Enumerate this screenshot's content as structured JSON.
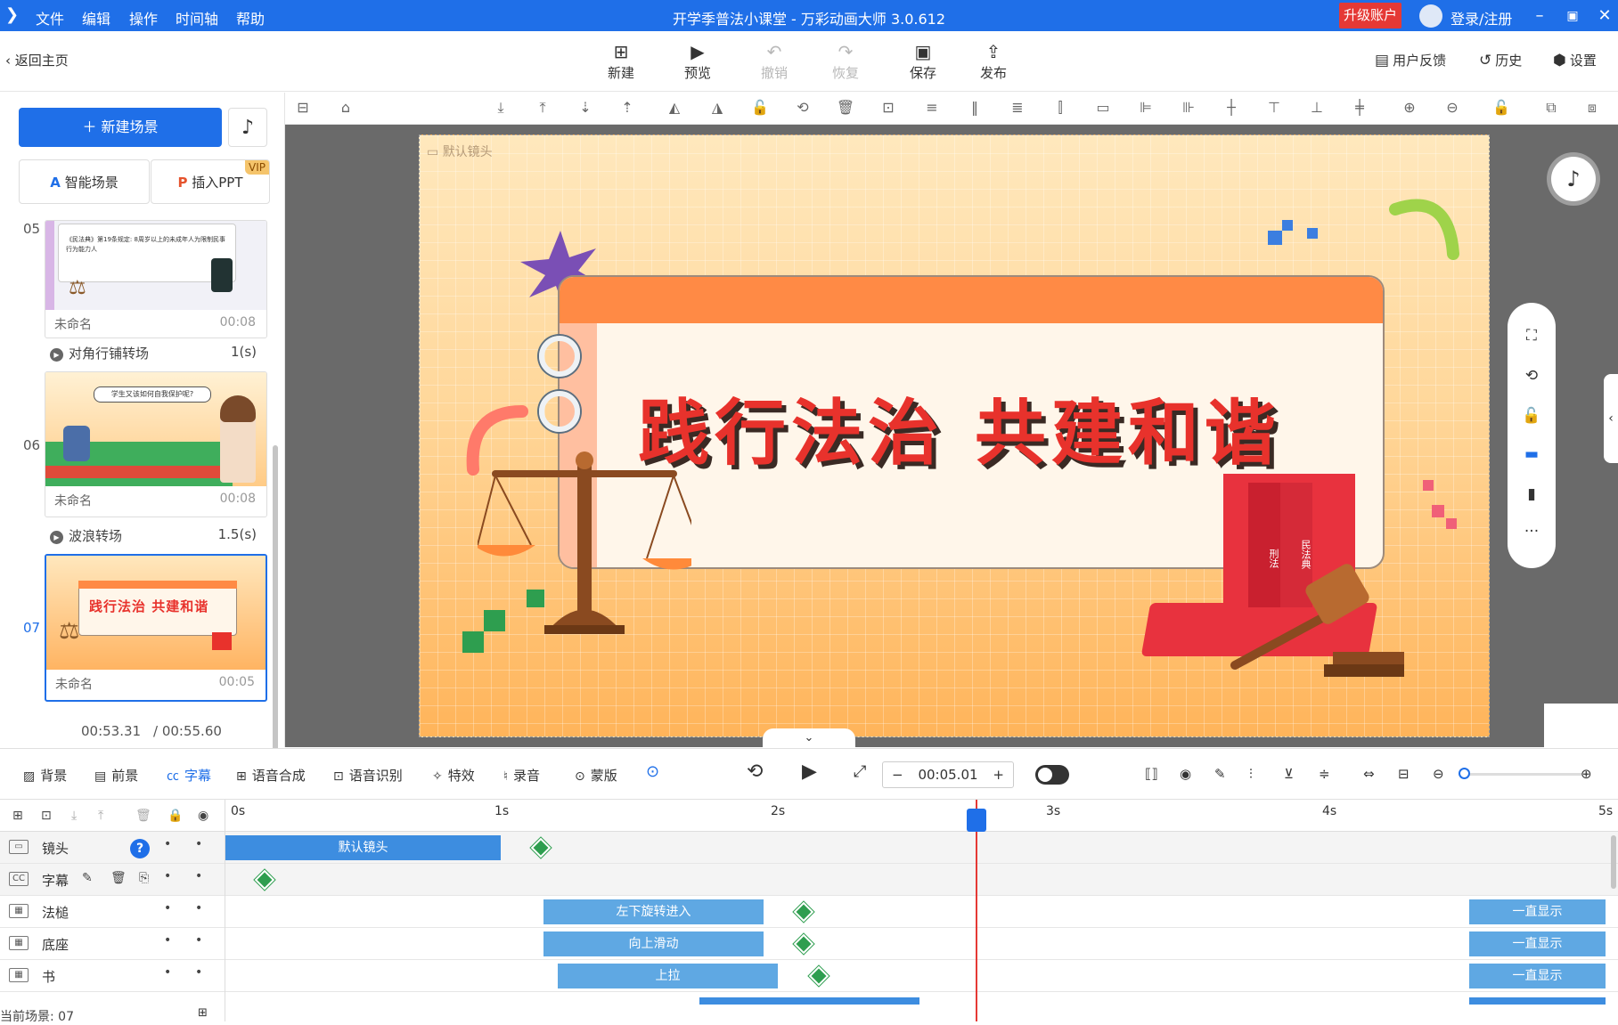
{
  "titlebar": {
    "menus": [
      "文件",
      "编辑",
      "操作",
      "时间轴",
      "帮助"
    ],
    "title": "开学季普法小课堂 - 万彩动画大师 3.0.612",
    "upgrade": "升级账户",
    "login": "登录/注册"
  },
  "toolbar": {
    "back": "返回主页",
    "new": "新建",
    "preview": "预览",
    "undo": "撤销",
    "redo": "恢复",
    "save": "保存",
    "publish": "发布",
    "feedback": "用户反馈",
    "history": "历史",
    "settings": "设置"
  },
  "left": {
    "new_scene": "新建场景",
    "smart_scene": "智能场景",
    "insert_ppt": "插入PPT",
    "vip": "VIP",
    "scenes": [
      {
        "num": "05",
        "name": "未命名",
        "duration": "00:08"
      },
      {
        "num": "06",
        "name": "未命名",
        "duration": "00:08"
      },
      {
        "num": "07",
        "name": "未命名",
        "duration": "00:05"
      }
    ],
    "transitions": [
      {
        "name": "对角行铺转场",
        "duration": "1(s)"
      },
      {
        "name": "波浪转场",
        "duration": "1.5(s)"
      }
    ],
    "time_current": "00:53.31",
    "time_total": "/ 00:55.60"
  },
  "stage": {
    "lens_label": "默认镜头",
    "headline": "践行法治  共建和谐",
    "book1": "刑法",
    "book2": "民法典",
    "thumb05_text": "《民法典》第19条规定: 8周岁以上的未成年人为限制民事行为能力人",
    "thumb06_text": "学生又该如何自我保护呢?"
  },
  "bottom": {
    "background": "背景",
    "foreground": "前景",
    "subtitle": "字幕",
    "tts": "语音合成",
    "asr": "语音识别",
    "effects": "特效",
    "record": "录音",
    "mask": "蒙版",
    "time": "00:05.01"
  },
  "timeline": {
    "ticks": [
      "0s",
      "1s",
      "2s",
      "3s",
      "4s",
      "5s"
    ],
    "rows": [
      {
        "label": "镜头"
      },
      {
        "label": "字幕"
      },
      {
        "label": "法槌",
        "clip": "左下旋转进入",
        "end": "一直显示"
      },
      {
        "label": "底座",
        "clip": "向上滑动",
        "end": "一直显示"
      },
      {
        "label": "书",
        "clip": "上拉",
        "end": "一直显示"
      }
    ],
    "lens_clip": "默认镜头",
    "current_scene": "当前场景: 07"
  },
  "colors": {
    "accent": "#1f6fe8",
    "headline": "#e8322c",
    "playhead": "#e53935"
  }
}
